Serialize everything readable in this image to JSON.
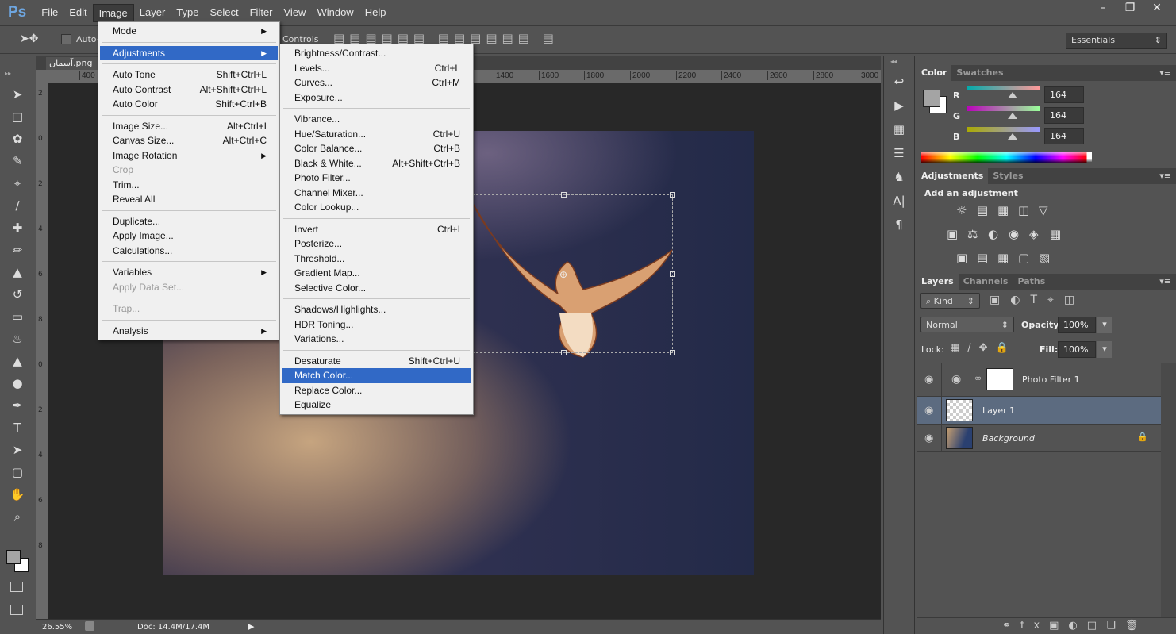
{
  "app": {
    "logo": "Ps",
    "menus": [
      "File",
      "Edit",
      "Image",
      "Layer",
      "Type",
      "Select",
      "Filter",
      "View",
      "Window",
      "Help"
    ],
    "active_menu": "Image",
    "window_controls": [
      "minimize",
      "restore",
      "close"
    ]
  },
  "options_bar": {
    "auto_select_label": "Auto-",
    "transform_controls_label": "Controls",
    "workspace": "Essentials"
  },
  "document": {
    "tab_title": "آسمان.png",
    "zoom": "26.55%",
    "doc_size": "Doc: 14.4M/17.4M"
  },
  "ruler": {
    "top": [
      "400",
      "1400",
      "1600",
      "1800",
      "2000",
      "2200",
      "2400",
      "2600",
      "2800",
      "3000"
    ],
    "left": [
      "2",
      "0",
      "2",
      "4",
      "6",
      "8",
      "0",
      "2",
      "4",
      "6",
      "8"
    ]
  },
  "image_menu": [
    {
      "label": "Mode",
      "submenu": true
    },
    {
      "sep": true
    },
    {
      "label": "Adjustments",
      "submenu": true,
      "highlighted": true
    },
    {
      "sep": true
    },
    {
      "label": "Auto Tone",
      "shortcut": "Shift+Ctrl+L"
    },
    {
      "label": "Auto Contrast",
      "shortcut": "Alt+Shift+Ctrl+L"
    },
    {
      "label": "Auto Color",
      "shortcut": "Shift+Ctrl+B"
    },
    {
      "sep": true
    },
    {
      "label": "Image Size...",
      "shortcut": "Alt+Ctrl+I"
    },
    {
      "label": "Canvas Size...",
      "shortcut": "Alt+Ctrl+C"
    },
    {
      "label": "Image Rotation",
      "submenu": true
    },
    {
      "label": "Crop",
      "disabled": true
    },
    {
      "label": "Trim..."
    },
    {
      "label": "Reveal All"
    },
    {
      "sep": true
    },
    {
      "label": "Duplicate..."
    },
    {
      "label": "Apply Image..."
    },
    {
      "label": "Calculations..."
    },
    {
      "sep": true
    },
    {
      "label": "Variables",
      "submenu": true
    },
    {
      "label": "Apply Data Set...",
      "disabled": true
    },
    {
      "sep": true
    },
    {
      "label": "Trap...",
      "disabled": true
    },
    {
      "sep": true
    },
    {
      "label": "Analysis",
      "submenu": true
    }
  ],
  "adjustments_menu": [
    {
      "label": "Brightness/Contrast..."
    },
    {
      "label": "Levels...",
      "shortcut": "Ctrl+L"
    },
    {
      "label": "Curves...",
      "shortcut": "Ctrl+M"
    },
    {
      "label": "Exposure..."
    },
    {
      "sep": true
    },
    {
      "label": "Vibrance..."
    },
    {
      "label": "Hue/Saturation...",
      "shortcut": "Ctrl+U"
    },
    {
      "label": "Color Balance...",
      "shortcut": "Ctrl+B"
    },
    {
      "label": "Black & White...",
      "shortcut": "Alt+Shift+Ctrl+B"
    },
    {
      "label": "Photo Filter..."
    },
    {
      "label": "Channel Mixer..."
    },
    {
      "label": "Color Lookup..."
    },
    {
      "sep": true
    },
    {
      "label": "Invert",
      "shortcut": "Ctrl+I"
    },
    {
      "label": "Posterize..."
    },
    {
      "label": "Threshold..."
    },
    {
      "label": "Gradient Map..."
    },
    {
      "label": "Selective Color..."
    },
    {
      "sep": true
    },
    {
      "label": "Shadows/Highlights..."
    },
    {
      "label": "HDR Toning..."
    },
    {
      "label": "Variations..."
    },
    {
      "sep": true
    },
    {
      "label": "Desaturate",
      "shortcut": "Shift+Ctrl+U"
    },
    {
      "label": "Match Color...",
      "highlighted": true
    },
    {
      "label": "Replace Color..."
    },
    {
      "label": "Equalize"
    }
  ],
  "color_panel": {
    "tabs": [
      "Color",
      "Swatches"
    ],
    "channels": [
      {
        "name": "R",
        "value": "164"
      },
      {
        "name": "G",
        "value": "164"
      },
      {
        "name": "B",
        "value": "164"
      }
    ],
    "foreground": "#a4a4a4",
    "background": "#ffffff"
  },
  "adjustments_panel": {
    "tabs": [
      "Adjustments",
      "Styles"
    ],
    "heading": "Add an adjustment"
  },
  "layers_panel": {
    "tabs": [
      "Layers",
      "Channels",
      "Paths"
    ],
    "filter": "Kind",
    "blend_mode": "Normal",
    "opacity_label": "Opacity:",
    "opacity": "100%",
    "lock_label": "Lock:",
    "fill_label": "Fill:",
    "fill": "100%",
    "layers": [
      {
        "name": "Photo Filter 1",
        "type": "adjustment"
      },
      {
        "name": "Layer 1",
        "selected": true
      },
      {
        "name": "Background",
        "locked": true
      }
    ]
  },
  "colors": {
    "accent": "#3169c6",
    "panel": "#535353",
    "canvas": "#282828"
  }
}
